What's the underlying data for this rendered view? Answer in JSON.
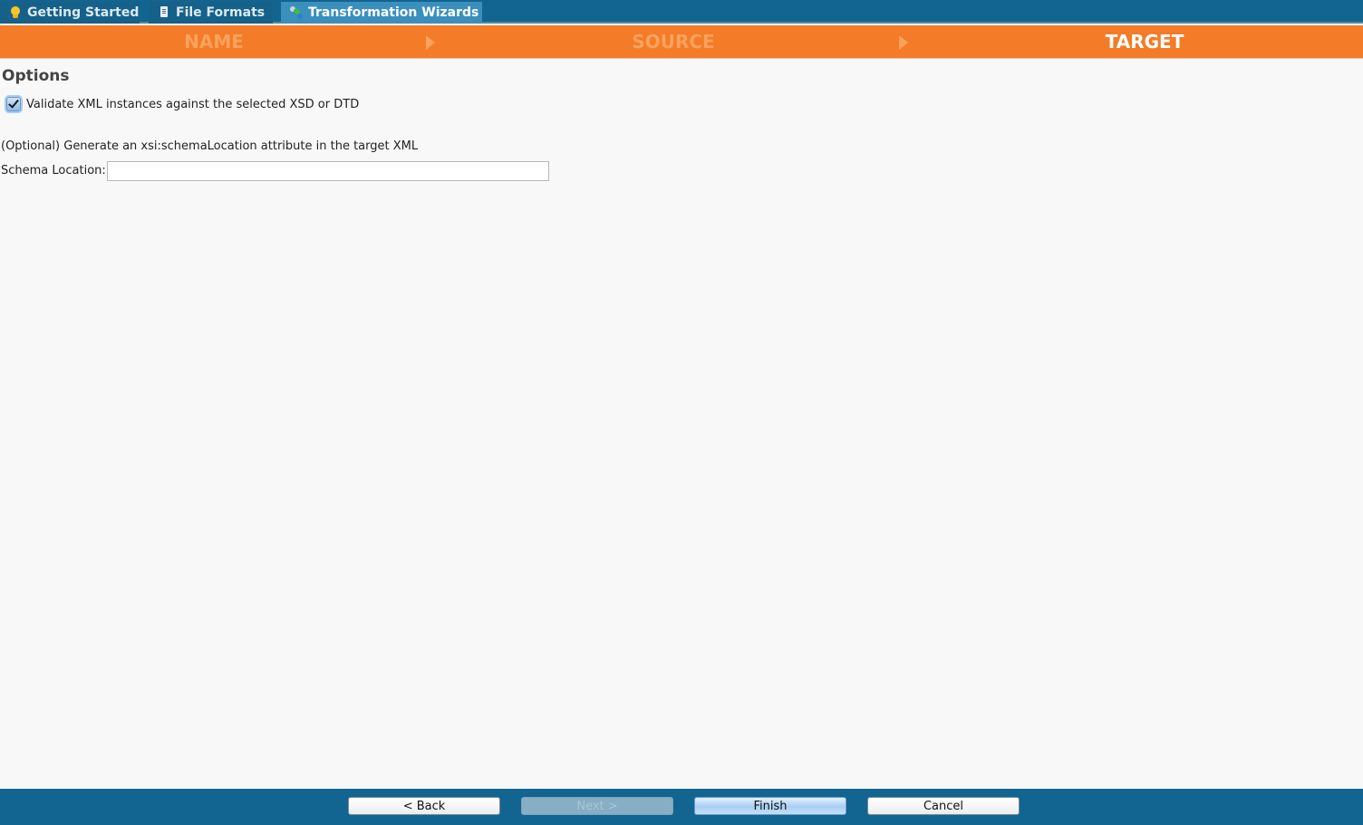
{
  "tabs": [
    {
      "label": "Getting Started",
      "icon": "lightbulb-icon",
      "active": false
    },
    {
      "label": "File Formats",
      "icon": "document-icon",
      "active": false
    },
    {
      "label": "Transformation Wizards",
      "icon": "wizard-icon",
      "active": true
    }
  ],
  "steps": [
    {
      "label": "NAME",
      "state": "done"
    },
    {
      "label": "SOURCE",
      "state": "done"
    },
    {
      "label": "TARGET",
      "state": "current"
    }
  ],
  "colors": {
    "tabbar": "#116590",
    "stepbar": "#f47b28",
    "step_inactive_text": "#f9a25c",
    "step_active_text": "#ffffff",
    "footer": "#116590"
  },
  "options": {
    "title": "Options",
    "validate_checkbox": {
      "label": "Validate XML instances against the selected XSD or DTD",
      "checked": true
    },
    "hint": "(Optional) Generate an xsi:schemaLocation attribute in the target XML",
    "schema_location": {
      "label": "Schema Location:",
      "value": "",
      "placeholder": ""
    }
  },
  "footer": {
    "back_label": "< Back",
    "next_label": "Next >",
    "finish_label": "Finish",
    "cancel_label": "Cancel",
    "next_enabled": false
  }
}
